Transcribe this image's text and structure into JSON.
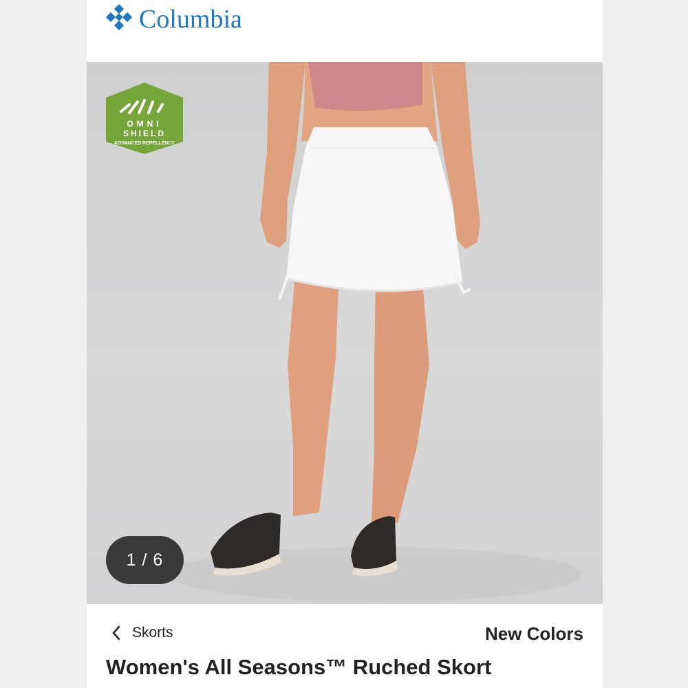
{
  "brand": {
    "name": "Columbia",
    "logo_icon": "columbia-diamond-logo",
    "color": "#1d78be"
  },
  "gallery": {
    "counter": "1 / 6",
    "badge": {
      "line1": "OMNI",
      "line2": "SHIELD",
      "line3": "ADVANCED REPELLENCY",
      "color": "#76a53a"
    }
  },
  "nav": {
    "back_icon": "chevron-left-icon",
    "category": "Skorts"
  },
  "product": {
    "tag": "New Colors",
    "title": "Women's All Seasons™ Ruched Skort"
  }
}
